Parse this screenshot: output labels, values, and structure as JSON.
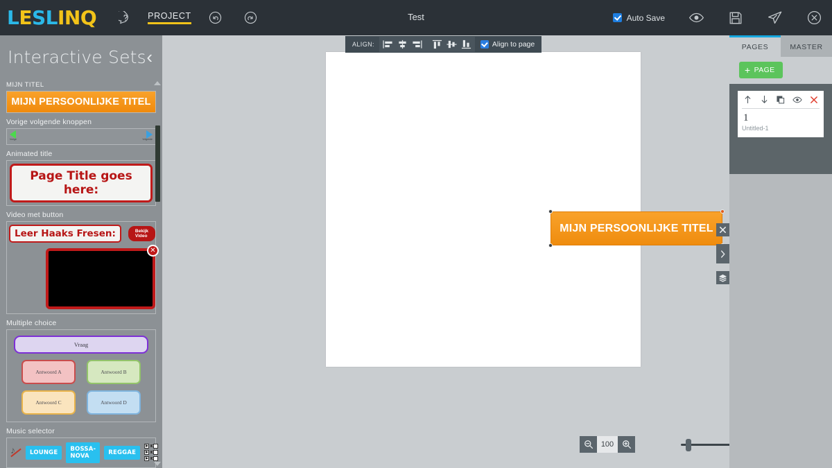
{
  "app": {
    "logo_part1": "LES",
    "logo_part2": "LINQ",
    "logo_letters": [
      {
        "ch": "L",
        "color": "cyan"
      },
      {
        "ch": "E",
        "color": "yellow"
      },
      {
        "ch": "S",
        "color": "cyan"
      },
      {
        "ch": "L",
        "color": "cyan"
      },
      {
        "ch": "I",
        "color": "yellow"
      },
      {
        "ch": "N",
        "color": "yellow"
      },
      {
        "ch": "Q",
        "color": "yellow"
      }
    ],
    "document_title": "Test"
  },
  "topbar": {
    "help_icon": "help-circle-icon",
    "project_label": "PROJECT",
    "undo_icon": "undo-icon",
    "redo_icon": "redo-icon",
    "autosave_label": "Auto Save",
    "autosave_checked": true,
    "preview_icon": "eye-icon",
    "save_icon": "floppy-disk-icon",
    "publish_icon": "paper-plane-icon",
    "close_icon": "close-circle-icon",
    "bg_color": "#2b3137",
    "accent_yellow": "#f2c319",
    "accent_cyan": "#2bb8e8"
  },
  "sidebar": {
    "title": "Interactive Sets",
    "collapse_icon": "chevron-left-icon",
    "sets": [
      {
        "label": "MIJN TITEL",
        "type": "title-button",
        "button_text": "MIJN PERSOONLIJKE TITEL",
        "color": "#f4950f"
      },
      {
        "label": "Vorige volgende knoppen",
        "type": "nav-buttons",
        "prev_label": "Vorige",
        "next_label": "Volgende"
      },
      {
        "label": "Animated title",
        "type": "animated-title",
        "text": "Page Title goes here:",
        "color": "#b71515"
      },
      {
        "label": "Video met button",
        "type": "video-with-button",
        "title_text": "Leer Haaks Fresen:",
        "button_text": "Bekijk Video",
        "close_icon": "close-circle-icon"
      },
      {
        "label": "Multiple choice",
        "type": "multiple-choice",
        "question": "Vraag",
        "answers": [
          "Antwoord A",
          "Antwoord B",
          "Antwoord C",
          "Antwoord D"
        ]
      },
      {
        "label": "Music selector",
        "type": "music-selector",
        "tracks": [
          "LOUNGE",
          "BOSSA-NOVA",
          "REGGAE"
        ],
        "note_icon": "music-note-muted-icon"
      }
    ]
  },
  "align_toolbar": {
    "label": "ALIGN:",
    "buttons": [
      {
        "name": "align-left-icon"
      },
      {
        "name": "align-center-horizontal-icon"
      },
      {
        "name": "align-right-icon"
      },
      {
        "name": "align-top-icon"
      },
      {
        "name": "align-middle-vertical-icon"
      },
      {
        "name": "align-bottom-icon"
      }
    ],
    "align_to_page_label": "Align to page",
    "align_to_page_checked": true
  },
  "canvas": {
    "selected_object_text": "MIJN PERSOONLIJKE TITEL",
    "selected_object_color": "#f4950f",
    "side_tools": [
      {
        "name": "close-tools-icon",
        "glyph": "✕"
      },
      {
        "name": "expand-panel-icon",
        "glyph": "›"
      },
      {
        "name": "layers-icon",
        "glyph": "≣"
      }
    ]
  },
  "zoom": {
    "zoom_out_icon": "zoom-out-icon",
    "value": "100",
    "zoom_in_icon": "zoom-in-icon",
    "slider_name": "zoom-slider"
  },
  "right_panel": {
    "tabs": [
      {
        "label": "PAGES",
        "active": true
      },
      {
        "label": "MASTER",
        "active": false
      }
    ],
    "add_page_label": "PAGE",
    "add_page_plus": "+",
    "page": {
      "number": "1",
      "name": "Untitled-1",
      "tools": [
        {
          "name": "move-up-icon"
        },
        {
          "name": "move-down-icon"
        },
        {
          "name": "duplicate-page-icon"
        },
        {
          "name": "toggle-visibility-icon"
        },
        {
          "name": "delete-page-icon"
        }
      ]
    }
  }
}
